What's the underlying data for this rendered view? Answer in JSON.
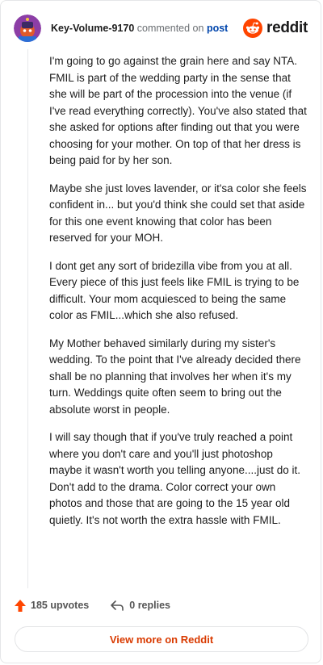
{
  "header": {
    "username": "Key-Volume-9170",
    "action_text": "commented on",
    "post_link_label": "post",
    "brand_name": "reddit"
  },
  "comment": {
    "paragraphs": [
      "I'm going to go against the grain here and say NTA. FMIL is part of the wedding party in the sense that she will be part of the procession into the venue (if I've read everything correctly). You've also stated that she asked for options after finding out that you were choosing for your mother. On top of that her dress is being paid for by her son.",
      "Maybe she just loves lavender, or it'sa color she feels confident in... but you'd think she could set that aside for this one event knowing that color has been reserved for your MOH.",
      "I dont get any sort of bridezilla vibe from you at all. Every piece of this just feels like FMIL is trying to be difficult. Your mom acquiesced to being the same color as FMIL...which she also refused.",
      "My Mother behaved similarly during my sister's wedding. To the point that I've already decided there shall be no planning that involves her when it's my turn. Weddings quite often seem to bring out the absolute worst in people.",
      "I will say though that if you've truly reached a point where you don't care and you'll just photoshop maybe it wasn't worth you telling anyone....just do it. Don't add to the drama. Color correct your own photos and those that are going to the 15 year old quietly. It's not worth the extra hassle with FMIL."
    ]
  },
  "footer": {
    "upvotes_label": "185 upvotes",
    "replies_label": "0 replies"
  },
  "view_more_label": "View more on Reddit",
  "colors": {
    "brand_orange": "#ff4500",
    "link_blue": "#0045ac",
    "cta_text": "#d93a00",
    "avatar_bg": "#8c3ea6"
  },
  "icons": {
    "avatar": "snoo-avatar",
    "logo": "reddit-snoo-icon",
    "upvote": "upvote-arrow-icon",
    "reply": "reply-arrow-icon"
  }
}
